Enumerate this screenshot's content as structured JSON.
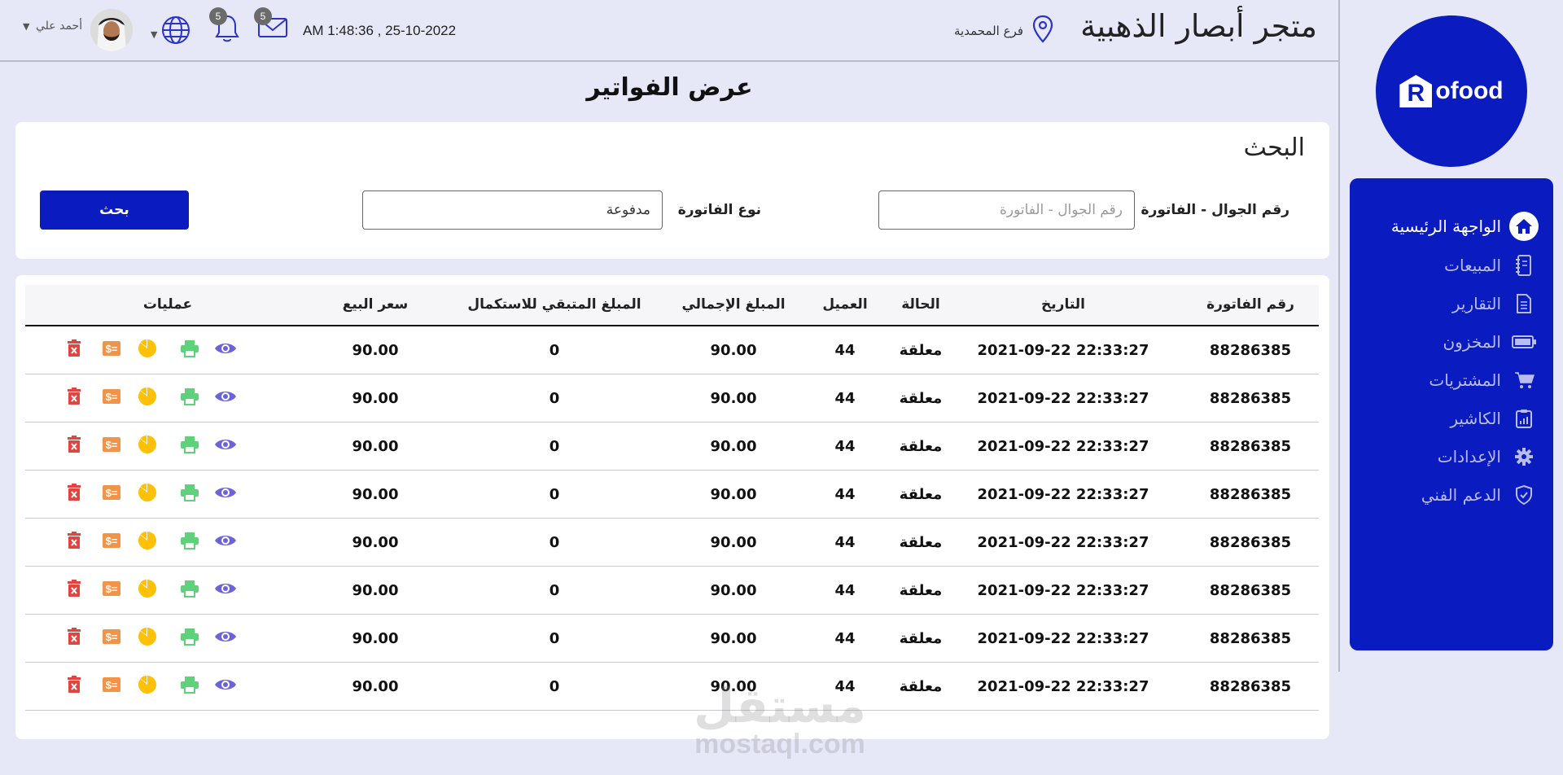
{
  "sidebar": {
    "logo_letter": "R",
    "logo_text": "ofood",
    "items": [
      {
        "label": "الواجهة الرئيسية",
        "icon": "home-icon",
        "active": true
      },
      {
        "label": "المبيعات",
        "icon": "notebook-icon",
        "active": false
      },
      {
        "label": "التقارير",
        "icon": "document-icon",
        "active": false
      },
      {
        "label": "المخزون",
        "icon": "battery-icon",
        "active": false
      },
      {
        "label": "المشتريات",
        "icon": "cart-icon",
        "active": false
      },
      {
        "label": "الكاشير",
        "icon": "clipboard-chart-icon",
        "active": false
      },
      {
        "label": "الإعدادات",
        "icon": "gear-icon",
        "active": false
      },
      {
        "label": "الدعم الفني",
        "icon": "shield-check-icon",
        "active": false
      }
    ]
  },
  "header": {
    "store_name": "متجر أبصار الذهبية",
    "branch": "فرع المحمدية",
    "datetime": "AM 1:48:36 , 25-10-2022",
    "messages_count": "5",
    "notifications_count": "5",
    "user_name": "أحمد علي"
  },
  "page": {
    "title": "عرض الفواتير"
  },
  "search": {
    "heading": "البحث",
    "phone_invoice_label": "رقم الجوال - الفاتورة",
    "phone_invoice_placeholder": "رقم الجوال - الفاتورة",
    "invoice_type_label": "نوع الفاتورة",
    "invoice_type_value": "مدفوعة",
    "search_button": "بحث"
  },
  "table": {
    "columns": {
      "invoice_no": "رقم الفاتورة",
      "date": "التاريخ",
      "status": "الحالة",
      "customer": "العميل",
      "total": "المبلغ الإجمالي",
      "remaining": "المبلغ المتبقي للاستكمال",
      "price": "سعر البيع",
      "actions": "عمليات"
    },
    "rows": [
      {
        "invoice_no": "88286385",
        "date": "2021-09-22 22:33:27",
        "status": "معلقة",
        "customer": "44",
        "total": "90.00",
        "remaining": "0",
        "price": "90.00"
      },
      {
        "invoice_no": "88286385",
        "date": "2021-09-22 22:33:27",
        "status": "معلقة",
        "customer": "44",
        "total": "90.00",
        "remaining": "0",
        "price": "90.00"
      },
      {
        "invoice_no": "88286385",
        "date": "2021-09-22 22:33:27",
        "status": "معلقة",
        "customer": "44",
        "total": "90.00",
        "remaining": "0",
        "price": "90.00"
      },
      {
        "invoice_no": "88286385",
        "date": "2021-09-22 22:33:27",
        "status": "معلقة",
        "customer": "44",
        "total": "90.00",
        "remaining": "0",
        "price": "90.00"
      },
      {
        "invoice_no": "88286385",
        "date": "2021-09-22 22:33:27",
        "status": "معلقة",
        "customer": "44",
        "total": "90.00",
        "remaining": "0",
        "price": "90.00"
      },
      {
        "invoice_no": "88286385",
        "date": "2021-09-22 22:33:27",
        "status": "معلقة",
        "customer": "44",
        "total": "90.00",
        "remaining": "0",
        "price": "90.00"
      },
      {
        "invoice_no": "88286385",
        "date": "2021-09-22 22:33:27",
        "status": "معلقة",
        "customer": "44",
        "total": "90.00",
        "remaining": "0",
        "price": "90.00"
      },
      {
        "invoice_no": "88286385",
        "date": "2021-09-22 22:33:27",
        "status": "معلقة",
        "customer": "44",
        "total": "90.00",
        "remaining": "0",
        "price": "90.00"
      }
    ],
    "action_icons": [
      "eye-icon",
      "print-icon",
      "pie-chart-icon",
      "cash-icon",
      "delete-icon"
    ]
  },
  "watermark": {
    "arabic": "مستقل",
    "latin": "mostaql.com"
  },
  "colors": {
    "primary": "#0a1bc0",
    "background": "#e6e7f7",
    "view": "#6c63d9",
    "print": "#5ed17a",
    "chart": "#ffc107",
    "cash": "#f0944a",
    "delete": "#e0463f"
  }
}
